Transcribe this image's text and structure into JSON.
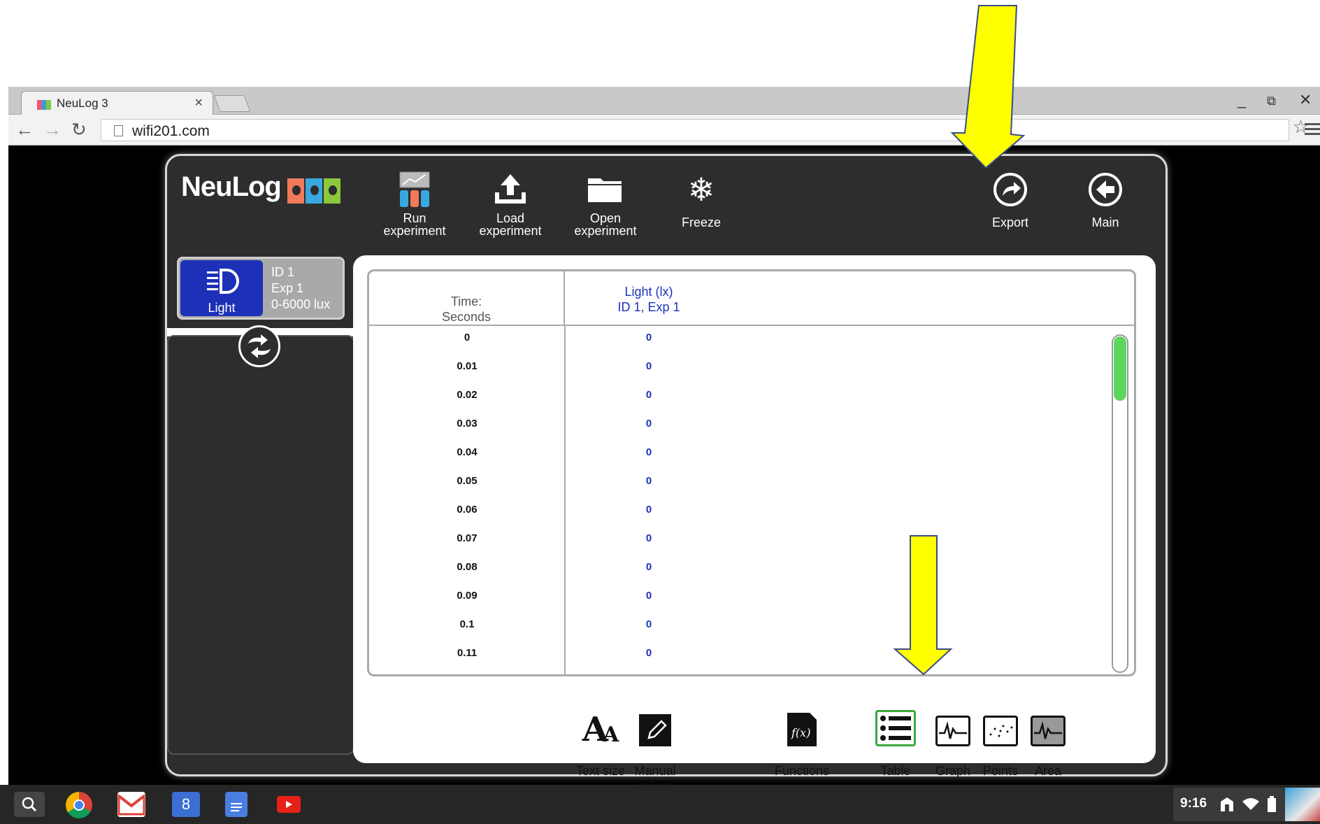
{
  "browser": {
    "tab_title": "NeuLog 3",
    "tab_close": "×",
    "url": "wifi201.com",
    "window_controls": [
      "_",
      "⧉",
      "✕"
    ]
  },
  "app": {
    "logo_text": "NeuLog",
    "toolbar": {
      "run": "Run\nexperiment",
      "load": "Load\nexperiment",
      "open": "Open\nexperiment",
      "freeze": "Freeze",
      "export": "Export",
      "main": "Main"
    },
    "sensor": {
      "name": "Light",
      "id": "ID 1",
      "exp": "Exp 1",
      "range": "0-6000 lux"
    },
    "table": {
      "time_header_1": "Time:",
      "time_header_2": "Seconds",
      "light_header_1": "Light (lx)",
      "light_header_2": "ID 1, Exp 1",
      "rows": [
        {
          "t": "0",
          "v": "0"
        },
        {
          "t": "0.01",
          "v": "0"
        },
        {
          "t": "0.02",
          "v": "0"
        },
        {
          "t": "0.03",
          "v": "0"
        },
        {
          "t": "0.04",
          "v": "0"
        },
        {
          "t": "0.05",
          "v": "0"
        },
        {
          "t": "0.06",
          "v": "0"
        },
        {
          "t": "0.07",
          "v": "0"
        },
        {
          "t": "0.08",
          "v": "0"
        },
        {
          "t": "0.09",
          "v": "0"
        },
        {
          "t": "0.1",
          "v": "0"
        },
        {
          "t": "0.11",
          "v": "0"
        }
      ]
    },
    "bottom_bar": {
      "text_size": "Text size",
      "manual_values": "Manual\nvalues",
      "functions": "Functions",
      "table": "Table",
      "graph": "Graph",
      "points": "Points",
      "area": "Area"
    }
  },
  "shelf": {
    "clock": "9:16"
  },
  "colors": {
    "accent_blue": "#1c31b8",
    "arrow_yellow": "#ffff00",
    "scroll_green": "#5ed65e"
  }
}
